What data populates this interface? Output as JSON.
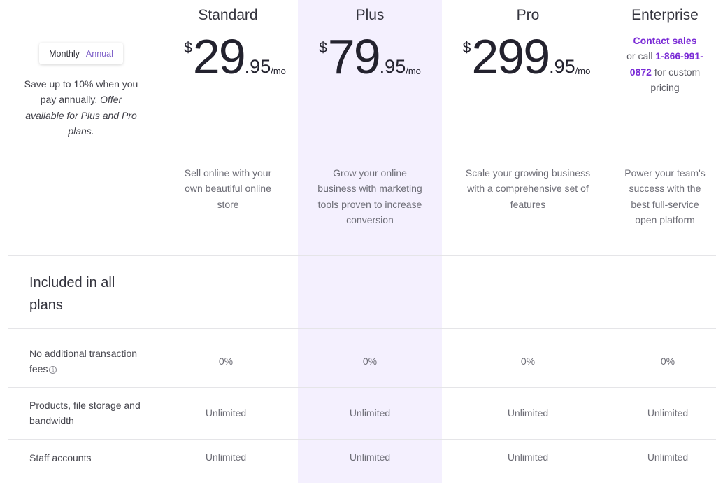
{
  "billing_toggle": {
    "monthly_label": "Monthly",
    "annual_label": "Annual",
    "selected": "Annual"
  },
  "save_note": {
    "text": "Save up to 10% when you pay annually.",
    "italic": "Offer available for Plus and Pro plans."
  },
  "plans": [
    {
      "name": "Standard",
      "currency": "$",
      "price_int": "29",
      "price_cents": ".95",
      "period": "/mo",
      "description": "Sell online with your own beautiful online store"
    },
    {
      "name": "Plus",
      "currency": "$",
      "price_int": "79",
      "price_cents": ".95",
      "period": "/mo",
      "description": "Grow your online business with marketing tools proven to increase conversion",
      "highlighted": true,
      "highlight_color": "#f4f0fe"
    },
    {
      "name": "Pro",
      "currency": "$",
      "price_int": "299",
      "price_cents": ".95",
      "period": "/mo",
      "description": "Scale your growing business with a comprehensive set of features"
    },
    {
      "name": "Enterprise",
      "contact_link": "Contact sales",
      "contact_mid": "or call",
      "phone": "1-866-991-0872",
      "contact_end": "for custom pricing",
      "link_color": "#7a2bd6",
      "description": "Power your team's success with the best full-service open platform"
    }
  ],
  "section": {
    "title": "Included in all plans"
  },
  "features": [
    {
      "label": "No additional transaction fees",
      "has_info_icon": true,
      "info_icon": "i",
      "values": [
        "0%",
        "0%",
        "0%",
        "0%"
      ]
    },
    {
      "label": "Products, file storage and bandwidth",
      "values": [
        "Unlimited",
        "Unlimited",
        "Unlimited",
        "Unlimited"
      ]
    },
    {
      "label": "Staff accounts",
      "values": [
        "Unlimited",
        "Unlimited",
        "Unlimited",
        "Unlimited"
      ]
    }
  ]
}
